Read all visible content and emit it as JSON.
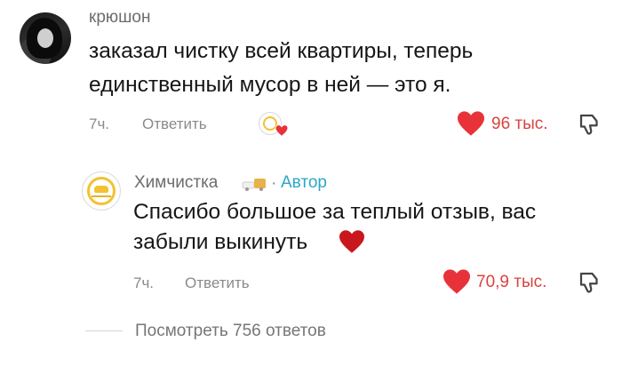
{
  "comment": {
    "username": "крюшон",
    "text_line1": "заказал чистку всей квартиры, теперь",
    "text_line2": "единственный мусор в ней — это я.",
    "time": "7ч.",
    "reply_label": "Ответить",
    "likes": "96 тыс."
  },
  "reply": {
    "author_name": "Химчистка",
    "separator": "·",
    "author_tag": "Автор",
    "text_line1": "Спасибо большое за теплый отзыв, вас",
    "text_line2": "забыли выкинуть",
    "time": "7ч.",
    "reply_label": "Ответить",
    "likes": "70,9 тыс."
  },
  "view_replies": "Посмотреть 756 ответов",
  "colors": {
    "like_red": "#e8323a",
    "author_blue": "#2aa7c9",
    "brand_yellow": "#f2c230"
  },
  "icons": {
    "like": "heart-icon",
    "dislike": "thumbs-down-icon",
    "emoji": "red-heart-emoji",
    "author_badge": "truck-sofa-icon"
  }
}
